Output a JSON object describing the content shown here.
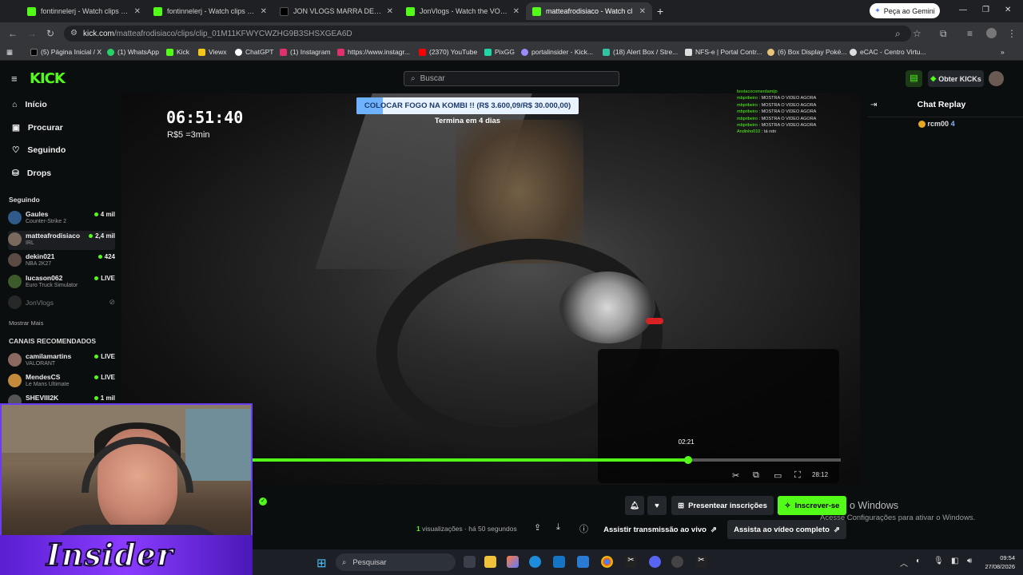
{
  "browser": {
    "tabs": [
      {
        "label": "fontinnelerj - Watch clips on Ki",
        "icon": "kick-favicon"
      },
      {
        "label": "fontinnelerj - Watch clips on Ki",
        "icon": "kick-favicon"
      },
      {
        "label": "JON VLOGS MARRA DE NEYMA",
        "icon": "tiktok-favicon"
      },
      {
        "label": "JonVlogs - Watch the VOD on K",
        "icon": "kick-favicon"
      },
      {
        "label": "matteafrodisiaco - Watch cl",
        "icon": "kick-favicon"
      }
    ],
    "gemini_label": "Peça ao Gemini",
    "url_host": "kick.com",
    "url_path": "/matteafrodisiaco/clips/clip_01M11KFWYCWZHG9B3SHSXGEA6D",
    "bookmarks": [
      "(5) Página Inicial / X",
      "(1) WhatsApp",
      "Kick",
      "Viewx",
      "ChatGPT",
      "(1) Instagram",
      "https://www.instagr...",
      "(2370) YouTube",
      "PixGG",
      "portalinsider - Kick...",
      "(18) Alert Box / Stre...",
      "NFS-e | Portal Contr...",
      "(6) Box Display Poké...",
      "eCAC - Centro Virtu..."
    ]
  },
  "kick": {
    "logo": "KICK",
    "search_placeholder": "Buscar",
    "get_kicks": "Obter KICKs",
    "nav": [
      {
        "label": "Início",
        "icon": "home-icon"
      },
      {
        "label": "Procurar",
        "icon": "browse-icon"
      },
      {
        "label": "Seguindo",
        "icon": "heart-icon"
      },
      {
        "label": "Drops",
        "icon": "drops-icon"
      }
    ],
    "following_title": "Seguindo",
    "following": [
      {
        "name": "Gaules",
        "game": "Counter-Strike 2",
        "viewers": "4 mil"
      },
      {
        "name": "matteafrodisiaco",
        "game": "IRL",
        "viewers": "2,4 mil"
      },
      {
        "name": "dekin021",
        "game": "NBA 2K27",
        "viewers": "424"
      },
      {
        "name": "lucason062",
        "game": "Euro Truck Simulator",
        "viewers": "LIVE"
      },
      {
        "name": "JonVlogs",
        "game": "",
        "viewers": ""
      }
    ],
    "show_more": "Mostrar Mais",
    "recommended_title": "CANAIS RECOMENDADOS",
    "recommended": [
      {
        "name": "camilamartins",
        "game": "VALORANT",
        "viewers": "LIVE"
      },
      {
        "name": "MendesCS",
        "game": "Le Mans Ultimate",
        "viewers": "LIVE"
      },
      {
        "name": "SHEVIII2K",
        "game": "",
        "viewers": "1 mil"
      }
    ]
  },
  "player": {
    "timer": "06:51:40",
    "rate": "R$5 =3min",
    "goal_label": "COLOCAR FOGO NA KOMBI !! (R$ 3.600,09/R$ 30.000,00)",
    "goal_progress": 0.12,
    "goal_sub": "Termina em 4 dias",
    "overlay_chat": [
      {
        "user": "bostacocomerdamijo",
        "msg": ""
      },
      {
        "user": "mbpribeiro",
        "msg": "MOSTRA O VIDEO AGORA"
      },
      {
        "user": "mbpribeiro",
        "msg": "MOSTRA O VIDEO AGORA"
      },
      {
        "user": "mbpribeiro",
        "msg": "MOSTRA O VIDEO AGORA"
      },
      {
        "user": "mbpribeiro",
        "msg": "MOSTRA O VIDEO AGORA"
      },
      {
        "user": "mbpribeiro",
        "msg": "MOSTRA O VIDEO AGORA"
      },
      {
        "user": "Andinho010",
        "msg": "tá rstn"
      }
    ],
    "hover_time": "02:21",
    "progress": 0.74,
    "duration_partial": "2‌8:12"
  },
  "chat_replay": {
    "title": "Chat Replay",
    "user": "rcm00",
    "count": "4"
  },
  "actions": {
    "gift_subs": "Presentear inscrições",
    "subscribe": "Inscrever-se",
    "views_count": "1",
    "views_label": "visualizações",
    "age": "· há 50 segundos",
    "watch_live": "Assistir transmissão ao vivo",
    "watch_full": "Assista ao vídeo completo"
  },
  "windows": {
    "activate_title": "o Windows",
    "activate_sub": "Acesse Configurações para ativar o Windows.",
    "search_label": "Pesquisar",
    "time": "09:54",
    "date": "27/08/2026"
  },
  "webcam": {
    "brand": "Insider"
  }
}
